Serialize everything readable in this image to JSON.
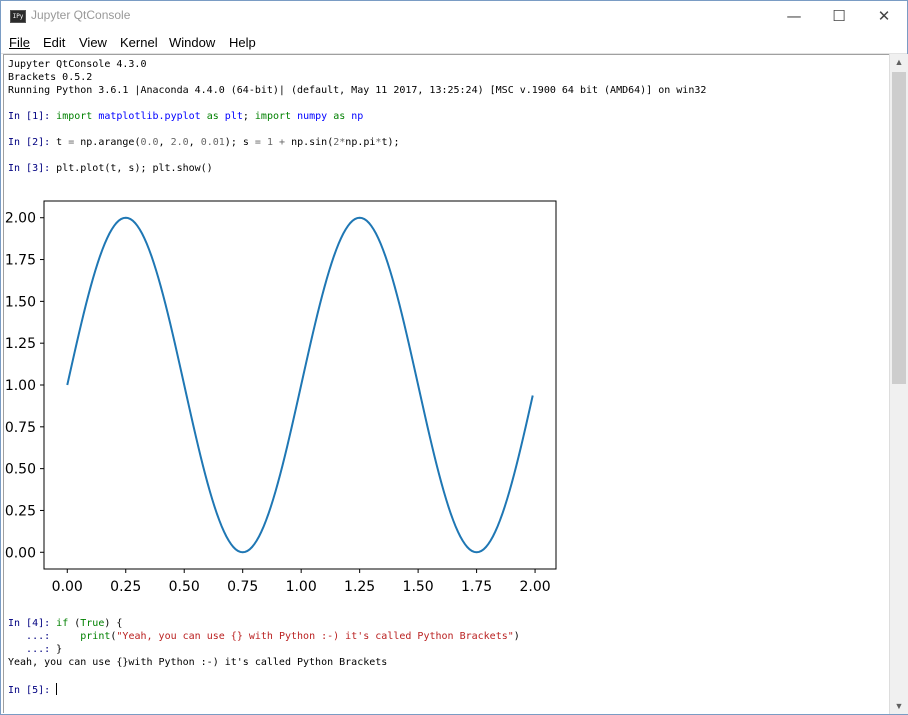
{
  "window": {
    "title": "Jupyter QtConsole",
    "icon_label": "IPy",
    "controls": {
      "minimize": "—",
      "maximize": "☐",
      "close": "✕"
    }
  },
  "menu": [
    {
      "label": "File"
    },
    {
      "label": "Edit"
    },
    {
      "label": "View"
    },
    {
      "label": "Kernel"
    },
    {
      "label": "Window"
    },
    {
      "label": "Help"
    }
  ],
  "console": {
    "banner": [
      "Jupyter QtConsole 4.3.0",
      "Brackets 0.5.2",
      "Running Python 3.6.1 |Anaconda 4.4.0 (64-bit)| (default, May 11 2017, 13:25:24) [MSC v.1900 64 bit (AMD64)] on win32"
    ],
    "cell1": {
      "prompt": "In [1]: ",
      "code": "import matplotlib.pyplot as plt; import numpy as np"
    },
    "cell2": {
      "prompt": "In [2]: ",
      "code": "t = np.arange(0.0, 2.0, 0.01); s = 1 + np.sin(2*np.pi*t);"
    },
    "cell3": {
      "prompt": "In [3]: ",
      "code": "plt.plot(t, s); plt.show()"
    },
    "cell4": {
      "prompt": "In [4]: ",
      "line1": "if (True) {",
      "cont_prompt": "   ...: ",
      "line2": "    print(\"Yeah, you can use {} with Python :-) it's called Python Brackets\")",
      "line3": "}",
      "output": "Yeah, you can use {}with Python :-) it's called Python Brackets"
    },
    "cell5": {
      "prompt": "In [5]: ",
      "code": ""
    }
  },
  "chart_data": {
    "type": "line",
    "title": "",
    "xlabel": "",
    "ylabel": "",
    "x_range": [
      0.0,
      1.99
    ],
    "x_step": 0.01,
    "function": "1 + sin(2*pi*t)",
    "xlim": [
      -0.0995,
      2.0895
    ],
    "ylim": [
      -0.1,
      2.1
    ],
    "x_ticks": [
      "0.00",
      "0.25",
      "0.50",
      "0.75",
      "1.00",
      "1.25",
      "1.50",
      "1.75",
      "2.00"
    ],
    "y_ticks": [
      "0.00",
      "0.25",
      "0.50",
      "0.75",
      "1.00",
      "1.25",
      "1.50",
      "1.75",
      "2.00"
    ],
    "series": [
      {
        "color": "#1f77b4"
      }
    ],
    "grid": false
  }
}
